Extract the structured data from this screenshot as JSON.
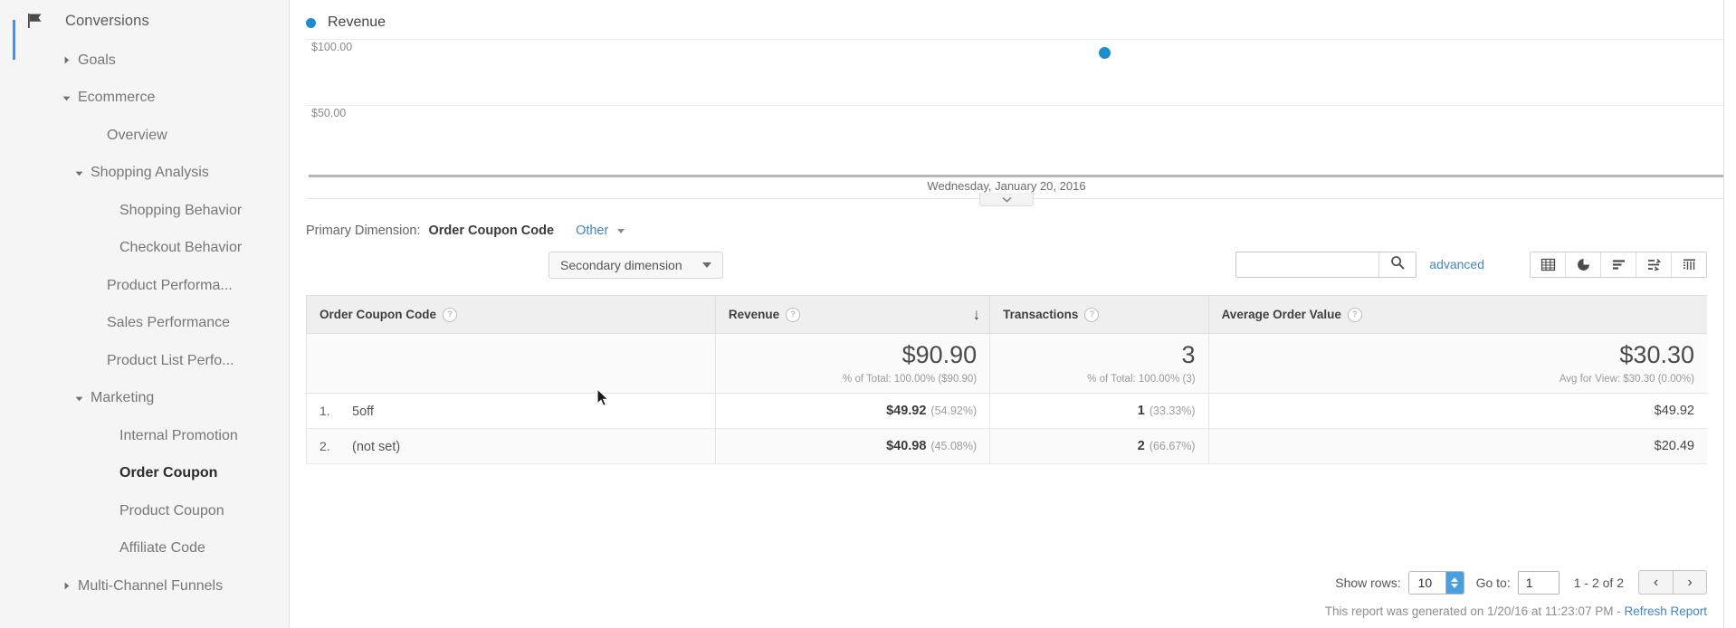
{
  "sidebar": {
    "section": {
      "icon": "flag-icon",
      "label": "Conversions"
    },
    "items": [
      {
        "label": "Goals",
        "level": 1,
        "caret": "right",
        "active": false
      },
      {
        "label": "Ecommerce",
        "level": 1,
        "caret": "down",
        "active": false
      },
      {
        "label": "Overview",
        "level": 2,
        "caret": "none",
        "active": false
      },
      {
        "label": "Shopping Analysis",
        "level": 2,
        "caret": "down",
        "active": false
      },
      {
        "label": "Shopping Behavior",
        "level": 3,
        "caret": "none",
        "active": false
      },
      {
        "label": "Checkout Behavior",
        "level": 3,
        "caret": "none",
        "active": false
      },
      {
        "label": "Product Performa...",
        "level": 2,
        "caret": "none",
        "active": false
      },
      {
        "label": "Sales Performance",
        "level": 2,
        "caret": "none",
        "active": false
      },
      {
        "label": "Product List Perfo...",
        "level": 2,
        "caret": "none",
        "active": false
      },
      {
        "label": "Marketing",
        "level": 2,
        "caret": "down",
        "active": false
      },
      {
        "label": "Internal Promotion",
        "level": 3,
        "caret": "none",
        "active": false
      },
      {
        "label": "Order Coupon",
        "level": 3,
        "caret": "none",
        "active": true
      },
      {
        "label": "Product Coupon",
        "level": 3,
        "caret": "none",
        "active": false
      },
      {
        "label": "Affiliate Code",
        "level": 3,
        "caret": "none",
        "active": false
      },
      {
        "label": "Multi-Channel Funnels",
        "level": 1,
        "caret": "right",
        "active": false
      }
    ]
  },
  "chart_data": {
    "type": "scatter",
    "title": "",
    "legend": [
      {
        "name": "Revenue",
        "color": "#1d8ecd"
      }
    ],
    "legend_position": "top-left",
    "series": [
      {
        "name": "Revenue",
        "values": [
          90.9
        ]
      }
    ],
    "x": [
      "Wednesday, January 20, 2016"
    ],
    "categories": [
      "Wednesday, January 20, 2016"
    ],
    "xlabel": "",
    "ylabel": "",
    "ylim": [
      0,
      125
    ],
    "yticks": [
      "$100.00",
      "$50.00"
    ],
    "ytick_values": [
      100,
      50
    ],
    "grid": true,
    "x_axis_label": "Wednesday, January 20, 2016"
  },
  "primary_dimension": {
    "label": "Primary Dimension:",
    "value": "Order Coupon Code",
    "other_label": "Other"
  },
  "toolbar": {
    "secondary_dimension_label": "Secondary dimension",
    "search_value": "",
    "search_placeholder": "",
    "search_icon": "search-icon",
    "advanced_label": "advanced",
    "view_icons": [
      "table-view-icon",
      "pie-chart-view-icon",
      "bar-chart-view-icon",
      "performance-view-icon",
      "pivot-view-icon"
    ]
  },
  "table": {
    "columns": [
      {
        "label": "Order Coupon Code",
        "align": "left",
        "help": "?"
      },
      {
        "label": "Revenue",
        "align": "left",
        "help": "?",
        "sorted": "desc",
        "sort_glyph": "↓"
      },
      {
        "label": "Transactions",
        "align": "left",
        "help": "?"
      },
      {
        "label": "Average Order Value",
        "align": "left",
        "help": "?"
      }
    ],
    "summary": {
      "revenue": {
        "value": "$90.90",
        "sub": "% of Total: 100.00% ($90.90)"
      },
      "transactions": {
        "value": "3",
        "sub": "% of Total: 100.00% (3)"
      },
      "aov": {
        "value": "$30.30",
        "sub": "Avg for View: $30.30 (0.00%)"
      }
    },
    "rows": [
      {
        "index": "1.",
        "dimension": "5off",
        "revenue": "$49.92",
        "revenue_pct": "(54.92%)",
        "transactions": "1",
        "transactions_pct": "(33.33%)",
        "aov": "$49.92"
      },
      {
        "index": "2.",
        "dimension": "(not set)",
        "revenue": "$40.98",
        "revenue_pct": "(45.08%)",
        "transactions": "2",
        "transactions_pct": "(66.67%)",
        "aov": "$20.49"
      }
    ]
  },
  "pagination": {
    "show_rows_label": "Show rows:",
    "rows_value": "10",
    "goto_label": "Go to:",
    "goto_value": "1",
    "range_text": "1 - 2 of 2",
    "prev_glyph": "‹",
    "next_glyph": "›"
  },
  "footer": {
    "text": "This report was generated on 1/20/16 at 11:23:07 PM - ",
    "link": "Refresh Report"
  },
  "colors": {
    "accent": "#4285c5",
    "series": "#1d8ecd",
    "sidebar_bg": "#f5f5f5",
    "stepper": "#4a9fe0"
  }
}
